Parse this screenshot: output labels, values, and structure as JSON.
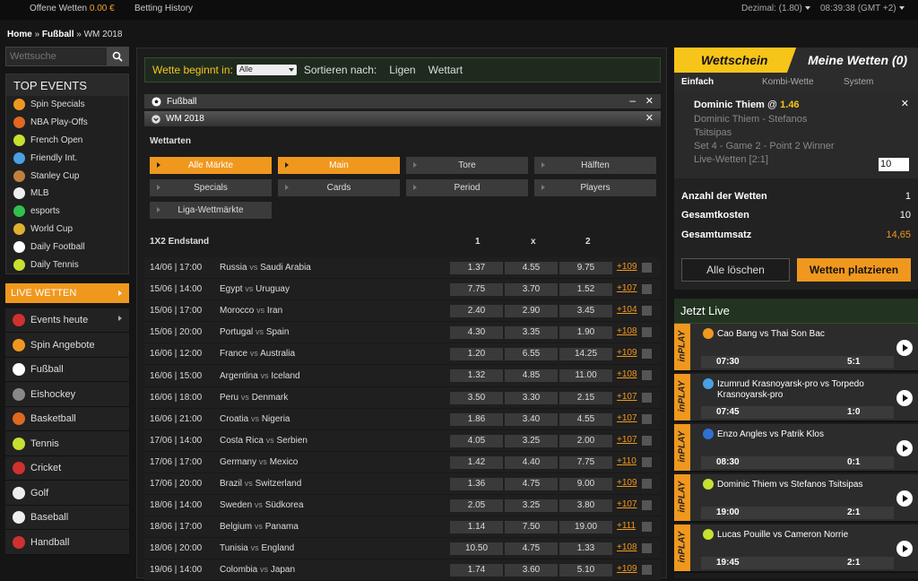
{
  "topbar": {
    "offene_label": "Offene Wetten",
    "offene_value": "0.00 €",
    "history": "Betting History",
    "odds_format": "Dezimal: (1.80)",
    "time": "08:39:38 (GMT +2)"
  },
  "breadcrumb": {
    "home": "Home",
    "sep1": "»",
    "sport": "Fußball",
    "sep2": "»",
    "event": "WM 2018"
  },
  "sidebar": {
    "search_placeholder": "Wettsuche",
    "top_events_title": "TOP EVENTS",
    "top_events": [
      {
        "label": "Spin Specials",
        "icon": "flame-icon",
        "color": "#f0981e"
      },
      {
        "label": "NBA Play-Offs",
        "icon": "basketball-icon",
        "color": "#e06820"
      },
      {
        "label": "French Open",
        "icon": "tennis-ball-icon",
        "color": "#c8e030"
      },
      {
        "label": "Friendly Int.",
        "icon": "globe-icon",
        "color": "#4aa0e0"
      },
      {
        "label": "Stanley Cup",
        "icon": "hockey-stick-icon",
        "color": "#c08040"
      },
      {
        "label": "MLB",
        "icon": "baseball-icon",
        "color": "#eeeeee"
      },
      {
        "label": "esports",
        "icon": "esports-icon",
        "color": "#30c050"
      },
      {
        "label": "World Cup",
        "icon": "trophy-icon",
        "color": "#e0b030"
      },
      {
        "label": "Daily Football",
        "icon": "football-icon",
        "color": "#ffffff"
      },
      {
        "label": "Daily Tennis",
        "icon": "tennis-ball-icon",
        "color": "#c8e030"
      }
    ],
    "live_label": "LIVE WETTEN",
    "sports": [
      {
        "label": "Events heute",
        "icon": "calendar-icon",
        "color": "#d03030",
        "arrow": true
      },
      {
        "label": "Spin Angebote",
        "icon": "flame-icon",
        "color": "#f0981e",
        "arrow": false
      },
      {
        "label": "Fußball",
        "icon": "football-icon",
        "color": "#ffffff",
        "arrow": false
      },
      {
        "label": "Eishockey",
        "icon": "puck-icon",
        "color": "#888888",
        "arrow": false
      },
      {
        "label": "Basketball",
        "icon": "basketball-icon",
        "color": "#e06820",
        "arrow": false
      },
      {
        "label": "Tennis",
        "icon": "tennis-ball-icon",
        "color": "#c8e030",
        "arrow": false
      },
      {
        "label": "Cricket",
        "icon": "cricket-ball-icon",
        "color": "#d03030",
        "arrow": false
      },
      {
        "label": "Golf",
        "icon": "golf-ball-icon",
        "color": "#eeeeee",
        "arrow": false
      },
      {
        "label": "Baseball",
        "icon": "baseball-icon",
        "color": "#eeeeee",
        "arrow": false
      },
      {
        "label": "Handball",
        "icon": "handball-icon",
        "color": "#d03030",
        "arrow": false
      }
    ]
  },
  "filter": {
    "label": "Wette beginnt in:",
    "select_value": "Alle",
    "sort_label": "Sortieren nach:",
    "sort_ligen": "Ligen",
    "sort_wettart": "Wettart"
  },
  "section": {
    "sport": "Fußball",
    "league": "WM 2018",
    "wettarten": "Wettarten"
  },
  "filters": [
    {
      "label": "Alle Märkte",
      "active": true
    },
    {
      "label": "Main",
      "active": true
    },
    {
      "label": "Tore",
      "active": false
    },
    {
      "label": "Hälften",
      "active": false
    },
    {
      "label": "Specials",
      "active": false
    },
    {
      "label": "Cards",
      "active": false
    },
    {
      "label": "Period",
      "active": false
    },
    {
      "label": "Players",
      "active": false
    },
    {
      "label": "Liga-Wettmärkte",
      "active": false
    }
  ],
  "market": {
    "title": "1X2 Endstand",
    "c1": "1",
    "cx": "x",
    "c2": "2"
  },
  "matches": [
    {
      "date": "14/06 | 17:00",
      "home": "Russia",
      "vs": "vs",
      "away": "Saudi Arabia",
      "o1": "1.37",
      "ox": "4.55",
      "o2": "9.75",
      "more": "+109"
    },
    {
      "date": "15/06 | 14:00",
      "home": "Egypt",
      "vs": "vs",
      "away": "Uruguay",
      "o1": "7.75",
      "ox": "3.70",
      "o2": "1.52",
      "more": "+107"
    },
    {
      "date": "15/06 | 17:00",
      "home": "Morocco",
      "vs": "vs",
      "away": "Iran",
      "o1": "2.40",
      "ox": "2.90",
      "o2": "3.45",
      "more": "+104"
    },
    {
      "date": "15/06 | 20:00",
      "home": "Portugal",
      "vs": "vs",
      "away": "Spain",
      "o1": "4.30",
      "ox": "3.35",
      "o2": "1.90",
      "more": "+108"
    },
    {
      "date": "16/06 | 12:00",
      "home": "France",
      "vs": "vs",
      "away": "Australia",
      "o1": "1.20",
      "ox": "6.55",
      "o2": "14.25",
      "more": "+109"
    },
    {
      "date": "16/06 | 15:00",
      "home": "Argentina",
      "vs": "vs",
      "away": "Iceland",
      "o1": "1.32",
      "ox": "4.85",
      "o2": "11.00",
      "more": "+108"
    },
    {
      "date": "16/06 | 18:00",
      "home": "Peru",
      "vs": "vs",
      "away": "Denmark",
      "o1": "3.50",
      "ox": "3.30",
      "o2": "2.15",
      "more": "+107"
    },
    {
      "date": "16/06 | 21:00",
      "home": "Croatia",
      "vs": "vs",
      "away": "Nigeria",
      "o1": "1.86",
      "ox": "3.40",
      "o2": "4.55",
      "more": "+107"
    },
    {
      "date": "17/06 | 14:00",
      "home": "Costa Rica",
      "vs": "vs",
      "away": "Serbien",
      "o1": "4.05",
      "ox": "3.25",
      "o2": "2.00",
      "more": "+107"
    },
    {
      "date": "17/06 | 17:00",
      "home": "Germany",
      "vs": "vs",
      "away": "Mexico",
      "o1": "1.42",
      "ox": "4.40",
      "o2": "7.75",
      "more": "+110"
    },
    {
      "date": "17/06 | 20:00",
      "home": "Brazil",
      "vs": "vs",
      "away": "Switzerland",
      "o1": "1.36",
      "ox": "4.75",
      "o2": "9.00",
      "more": "+109"
    },
    {
      "date": "18/06 | 14:00",
      "home": "Sweden",
      "vs": "vs",
      "away": "Südkorea",
      "o1": "2.05",
      "ox": "3.25",
      "o2": "3.80",
      "more": "+107"
    },
    {
      "date": "18/06 | 17:00",
      "home": "Belgium",
      "vs": "vs",
      "away": "Panama",
      "o1": "1.14",
      "ox": "7.50",
      "o2": "19.00",
      "more": "+111"
    },
    {
      "date": "18/06 | 20:00",
      "home": "Tunisia",
      "vs": "vs",
      "away": "England",
      "o1": "10.50",
      "ox": "4.75",
      "o2": "1.33",
      "more": "+108"
    },
    {
      "date": "19/06 | 14:00",
      "home": "Colombia",
      "vs": "vs",
      "away": "Japan",
      "o1": "1.74",
      "ox": "3.60",
      "o2": "5.10",
      "more": "+109"
    }
  ],
  "betslip": {
    "tab1": "Wettschein",
    "tab2": "Meine Wetten (0)",
    "sub1": "Einfach",
    "sub2": "Kombi-Wette",
    "sub3": "System",
    "player": "Dominic Thiem",
    "at": "@",
    "odd": "1.46",
    "line1": "Dominic Thiem - Stefanos",
    "line2": "Tsitsipas",
    "line3": "Set 4 - Game 2 - Point 2 Winner",
    "line4": "Live-Wetten [2:1]",
    "stake": "10",
    "count_label": "Anzahl der Wetten",
    "count_value": "1",
    "cost_label": "Gesamtkosten",
    "cost_value": "10",
    "return_label": "Gesamtumsatz",
    "return_value": "14,65",
    "clear": "Alle löschen",
    "place": "Wetten platzieren"
  },
  "live": {
    "title": "Jetzt Live",
    "inplay": "inPLAY",
    "items": [
      {
        "teams": "Cao Bang vs Thai Son Bac",
        "time": "07:30",
        "score": "5:1",
        "icon": "football-icon",
        "color": "#f0981e"
      },
      {
        "teams": "Izumrud Krasnoyarsk-pro vs Torpedo Krasnoyarsk-pro",
        "time": "07:45",
        "score": "1:0",
        "icon": "globe-icon",
        "color": "#4aa0e0"
      },
      {
        "teams": "Enzo Angles vs Patrik Klos",
        "time": "08:30",
        "score": "0:1",
        "icon": "badminton-icon",
        "color": "#3070d0"
      },
      {
        "teams": "Dominic Thiem vs Stefanos Tsitsipas",
        "time": "19:00",
        "score": "2:1",
        "icon": "tennis-ball-icon",
        "color": "#c8e030"
      },
      {
        "teams": "Lucas Pouille vs Cameron Norrie",
        "time": "19:45",
        "score": "2:1",
        "icon": "tennis-ball-icon",
        "color": "#c8e030"
      }
    ]
  }
}
